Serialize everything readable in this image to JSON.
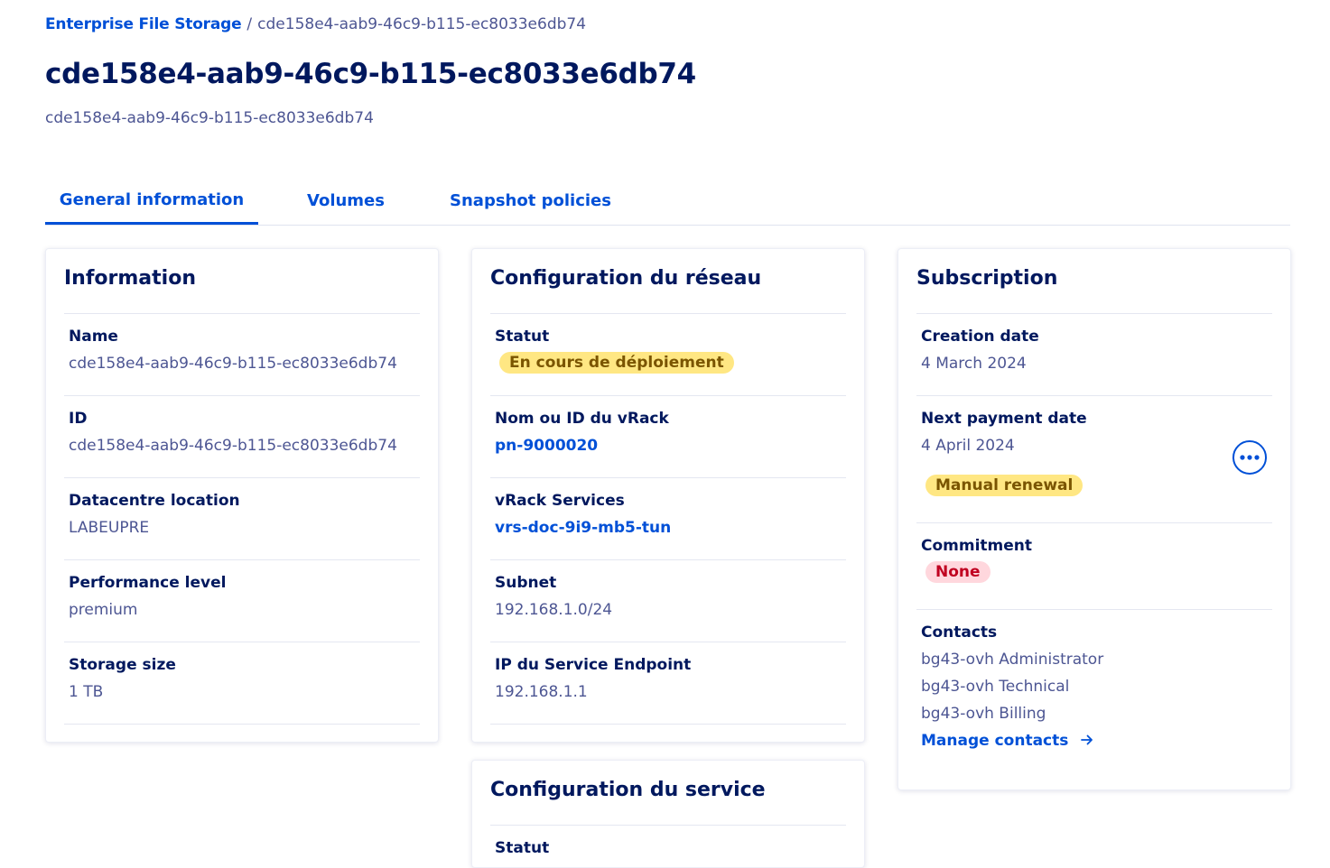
{
  "breadcrumb": {
    "root": "Enterprise File Storage",
    "separator": "/",
    "current": "cde158e4-aab9-46c9-b115-ec8033e6db74"
  },
  "page": {
    "title": "cde158e4-aab9-46c9-b115-ec8033e6db74",
    "subtitle": "cde158e4-aab9-46c9-b115-ec8033e6db74"
  },
  "tabs": [
    {
      "label": "General information",
      "active": true
    },
    {
      "label": "Volumes",
      "active": false
    },
    {
      "label": "Snapshot policies",
      "active": false
    }
  ],
  "information": {
    "title": "Information",
    "name_label": "Name",
    "name_value": "cde158e4-aab9-46c9-b115-ec8033e6db74",
    "id_label": "ID",
    "id_value": "cde158e4-aab9-46c9-b115-ec8033e6db74",
    "datacentre_label": "Datacentre location",
    "datacentre_value": "LABEUPRE",
    "performance_label": "Performance level",
    "performance_value": "premium",
    "storage_label": "Storage size",
    "storage_value": "1 TB"
  },
  "network": {
    "title": "Configuration du réseau",
    "status_label": "Statut",
    "status_value": "En cours de déploiement",
    "vrack_label": "Nom ou ID du vRack",
    "vrack_value": "pn-9000020",
    "vrack_services_label": "vRack Services",
    "vrack_services_value": "vrs-doc-9i9-mb5-tun",
    "subnet_label": "Subnet",
    "subnet_value": "192.168.1.0/24",
    "endpoint_label": "IP du Service Endpoint",
    "endpoint_value": "192.168.1.1"
  },
  "service": {
    "title": "Configuration du service",
    "status_label": "Statut"
  },
  "subscription": {
    "title": "Subscription",
    "creation_label": "Creation date",
    "creation_value": "4 March 2024",
    "payment_label": "Next payment date",
    "payment_value": "4 April 2024",
    "renewal_badge": "Manual renewal",
    "commitment_label": "Commitment",
    "commitment_value": "None",
    "contacts_label": "Contacts",
    "contacts": [
      "bg43-ovh Administrator",
      "bg43-ovh Technical",
      "bg43-ovh Billing"
    ],
    "manage_contacts": "Manage contacts",
    "more_icon": "ellipsis-icon",
    "arrow_icon": "arrow-right-icon"
  },
  "colors": {
    "primary": "#0050d7",
    "heading": "#00185e",
    "muted": "#4d5693",
    "warning_bg": "#ffe783",
    "error_bg": "#ffd7dd"
  }
}
